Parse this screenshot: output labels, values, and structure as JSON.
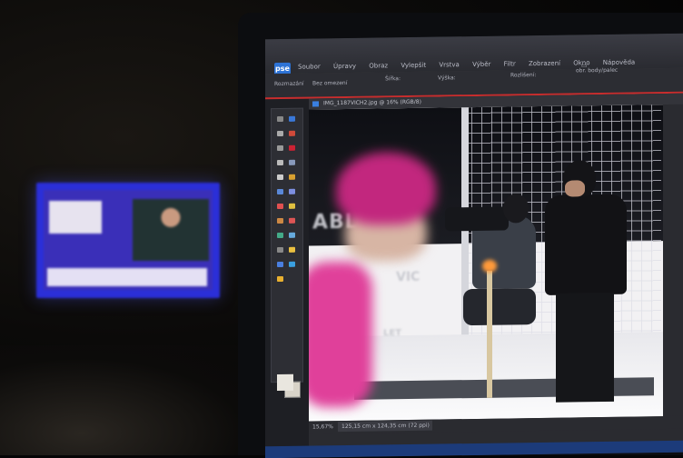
{
  "app": {
    "logo": "pse",
    "menu": [
      "Soubor",
      "Úpravy",
      "Obraz",
      "Vylepšit",
      "Vrstva",
      "Výběr",
      "Filtr",
      "Zobrazení",
      "Okno",
      "Nápověda"
    ],
    "options": [
      "Rozmazání",
      "Bez omezení",
      "Šířka:",
      "Výška:",
      "Rozlišení:",
      "obr. body/palec"
    ]
  },
  "document": {
    "title": "IMG_1187VICH2.jpg @ 16% (RGB/8)",
    "zoom": "15,67%",
    "size": "125,15 cm x 124,35 cm (72 ppi)"
  },
  "photo_text": {
    "banner_a": "ABL",
    "banner_b": "VIC",
    "banner_c": "LET"
  },
  "colors": {
    "accent_red": "#c82d2d",
    "tv_blue": "#2b2fd8",
    "skier_pink": "#e0409a"
  }
}
